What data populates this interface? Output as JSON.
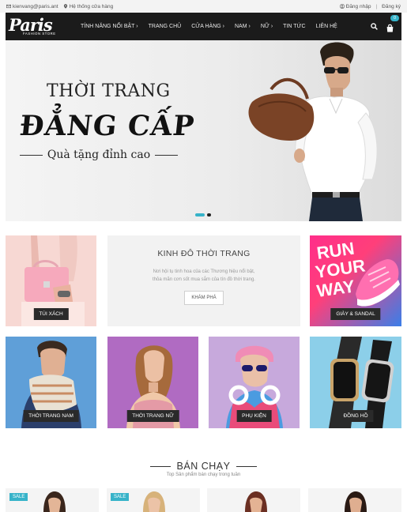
{
  "topbar": {
    "email": "kienvang@paris.ant",
    "stores": "Hệ thống cửa hàng",
    "login": "Đăng nhập",
    "separator": "|",
    "register": "Đăng ký"
  },
  "logo": {
    "brand": "Paris",
    "tagline": "FASHION STORE"
  },
  "nav": {
    "items": [
      {
        "label": "TÍNH NĂNG NỔI BẬT ›"
      },
      {
        "label": "TRANG CHỦ"
      },
      {
        "label": "CỬA HÀNG ›"
      },
      {
        "label": "NAM ›"
      },
      {
        "label": "NỮ ›"
      },
      {
        "label": "TIN TỨC"
      },
      {
        "label": "LIÊN HỆ"
      }
    ],
    "cart_count": "0"
  },
  "hero": {
    "line1": "THỜI TRANG",
    "line2": "ĐẲNG CẤP",
    "line3": "Quà tặng đỉnh cao",
    "slides": [
      {
        "active": true
      },
      {
        "active": false
      }
    ]
  },
  "categories": {
    "tui_xach": "TÚI XÁCH",
    "giay_sandal": "GIÀY & SANDAL",
    "thoi_trang_nam": "THỜI TRANG NAM",
    "thoi_trang_nu": "THỜI TRANG NỮ",
    "phu_kien": "PHỤ KIỆN",
    "dong_ho": "ĐỒNG HỒ"
  },
  "promo": {
    "title": "KINH ĐÔ THỜI TRANG",
    "description": "Nơi hội tụ tinh hoa của các Thương hiệu nổi bật, thỏa mãn cơn sốt mua sắm của tín đồ thời trang.",
    "button": "KHÁM PHÁ"
  },
  "shoes_banner": {
    "line1": "RUN",
    "line2": "YOUR",
    "line3": "WAY"
  },
  "bestseller": {
    "title": "BÁN CHẠY",
    "subtitle": "Top Sản phẩm bán chạy trong tuần",
    "sale_label": "SALE"
  },
  "colors": {
    "accent": "#37b3c9",
    "nav_bg": "#1b1b1b"
  }
}
